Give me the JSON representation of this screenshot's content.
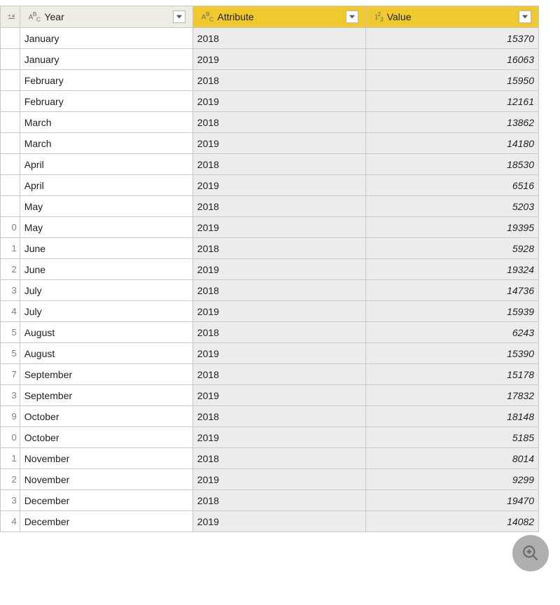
{
  "columns": {
    "c0": {
      "label": "Year",
      "type_icon": "abc",
      "selected": false
    },
    "c1": {
      "label": "Attribute",
      "type_icon": "abc",
      "selected": true
    },
    "c2": {
      "label": "Value",
      "type_icon": "123",
      "selected": true
    }
  },
  "row_number_icon": "table-options-icon",
  "rows": [
    {
      "n": "",
      "year": "January",
      "attr": "2018",
      "val": "15370"
    },
    {
      "n": "",
      "year": "January",
      "attr": "2019",
      "val": "16063"
    },
    {
      "n": "",
      "year": "February",
      "attr": "2018",
      "val": "15950"
    },
    {
      "n": "",
      "year": "February",
      "attr": "2019",
      "val": "12161"
    },
    {
      "n": "",
      "year": "March",
      "attr": "2018",
      "val": "13862"
    },
    {
      "n": "",
      "year": "March",
      "attr": "2019",
      "val": "14180"
    },
    {
      "n": "",
      "year": "April",
      "attr": "2018",
      "val": "18530"
    },
    {
      "n": "",
      "year": "April",
      "attr": "2019",
      "val": "6516"
    },
    {
      "n": "",
      "year": "May",
      "attr": "2018",
      "val": "5203"
    },
    {
      "n": "0",
      "year": "May",
      "attr": "2019",
      "val": "19395"
    },
    {
      "n": "1",
      "year": "June",
      "attr": "2018",
      "val": "5928"
    },
    {
      "n": "2",
      "year": "June",
      "attr": "2019",
      "val": "19324"
    },
    {
      "n": "3",
      "year": "July",
      "attr": "2018",
      "val": "14736"
    },
    {
      "n": "4",
      "year": "July",
      "attr": "2019",
      "val": "15939"
    },
    {
      "n": "5",
      "year": "August",
      "attr": "2018",
      "val": "6243"
    },
    {
      "n": "5",
      "year": "August",
      "attr": "2019",
      "val": "15390"
    },
    {
      "n": "7",
      "year": "September",
      "attr": "2018",
      "val": "15178"
    },
    {
      "n": "3",
      "year": "September",
      "attr": "2019",
      "val": "17832"
    },
    {
      "n": "9",
      "year": "October",
      "attr": "2018",
      "val": "18148"
    },
    {
      "n": "0",
      "year": "October",
      "attr": "2019",
      "val": "5185"
    },
    {
      "n": "1",
      "year": "November",
      "attr": "2018",
      "val": "8014"
    },
    {
      "n": "2",
      "year": "November",
      "attr": "2019",
      "val": "9299"
    },
    {
      "n": "3",
      "year": "December",
      "attr": "2018",
      "val": "19470"
    },
    {
      "n": "4",
      "year": "December",
      "attr": "2019",
      "val": "14082"
    }
  ]
}
